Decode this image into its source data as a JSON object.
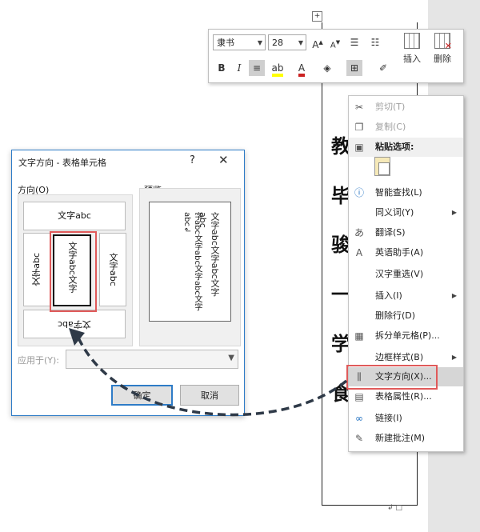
{
  "document": {
    "table_handle": "+",
    "cell_chars": [
      "教",
      "毕",
      "骏",
      "一",
      "学",
      "食"
    ],
    "end_mark": "↲ □"
  },
  "mini_toolbar": {
    "font_name": "隶书",
    "font_size": "28",
    "grow_font": "A",
    "shrink_font": "A",
    "bold": "B",
    "italic": "I",
    "insert_label": "插入",
    "delete_label": "删除",
    "accent_red": "#cc2222",
    "highlight_yellow": "#ffff00"
  },
  "context_menu": {
    "items": [
      {
        "icon": "cut-icon",
        "glyph": "✂",
        "label": "剪切(T)",
        "disabled": true
      },
      {
        "icon": "copy-icon",
        "glyph": "❐",
        "label": "复制(C)",
        "disabled": true
      },
      {
        "icon": "paste-icon",
        "glyph": "📋",
        "label": "粘贴选项:",
        "header": true
      },
      {
        "icon": "smart-lookup-icon",
        "glyph": "ⓘ",
        "label": "智能查找(L)"
      },
      {
        "icon": "none",
        "glyph": "",
        "label": "同义词(Y)",
        "submenu": true
      },
      {
        "icon": "translate-icon",
        "glyph": "あ",
        "label": "翻译(S)"
      },
      {
        "icon": "english-assistant-icon",
        "glyph": "A",
        "label": "英语助手(A)"
      },
      {
        "icon": "none",
        "glyph": "",
        "label": "汉字重选(V)"
      },
      {
        "icon": "none",
        "glyph": "",
        "label": "插入(I)",
        "submenu": true
      },
      {
        "icon": "none",
        "glyph": "",
        "label": "删除行(D)"
      },
      {
        "icon": "split-cells-icon",
        "glyph": "▦",
        "label": "拆分单元格(P)..."
      },
      {
        "icon": "none",
        "glyph": "",
        "label": "边框样式(B)",
        "submenu": true
      },
      {
        "icon": "text-direction-icon",
        "glyph": "⫼",
        "label": "文字方向(X)...",
        "highlighted": true
      },
      {
        "icon": "table-properties-icon",
        "glyph": "▤",
        "label": "表格属性(R)..."
      },
      {
        "icon": "link-icon",
        "glyph": "∞",
        "label": "链接(I)"
      },
      {
        "icon": "new-comment-icon",
        "glyph": "✎",
        "label": "新建批注(M)"
      }
    ],
    "highlight_color": "#e05a5a"
  },
  "dialog": {
    "title": "文字方向 - 表格单元格",
    "help": "?",
    "close": "✕",
    "orientation_label": "方向(O)",
    "preview_label": "预览",
    "options": {
      "horizontal": "文字abc",
      "vertical_up": "文字abc",
      "vertical_stacked": "文字abc文字",
      "vertical_down": "文字abc",
      "horizontal_flipped": "文字abc"
    },
    "preview_text_col1": "文字abc文字abc文字abc",
    "preview_text_col2": "字abc文字abc文字abc文字abc↲",
    "apply_to_label": "应用于(Y):",
    "ok_label": "确定",
    "cancel_label": "取消"
  }
}
